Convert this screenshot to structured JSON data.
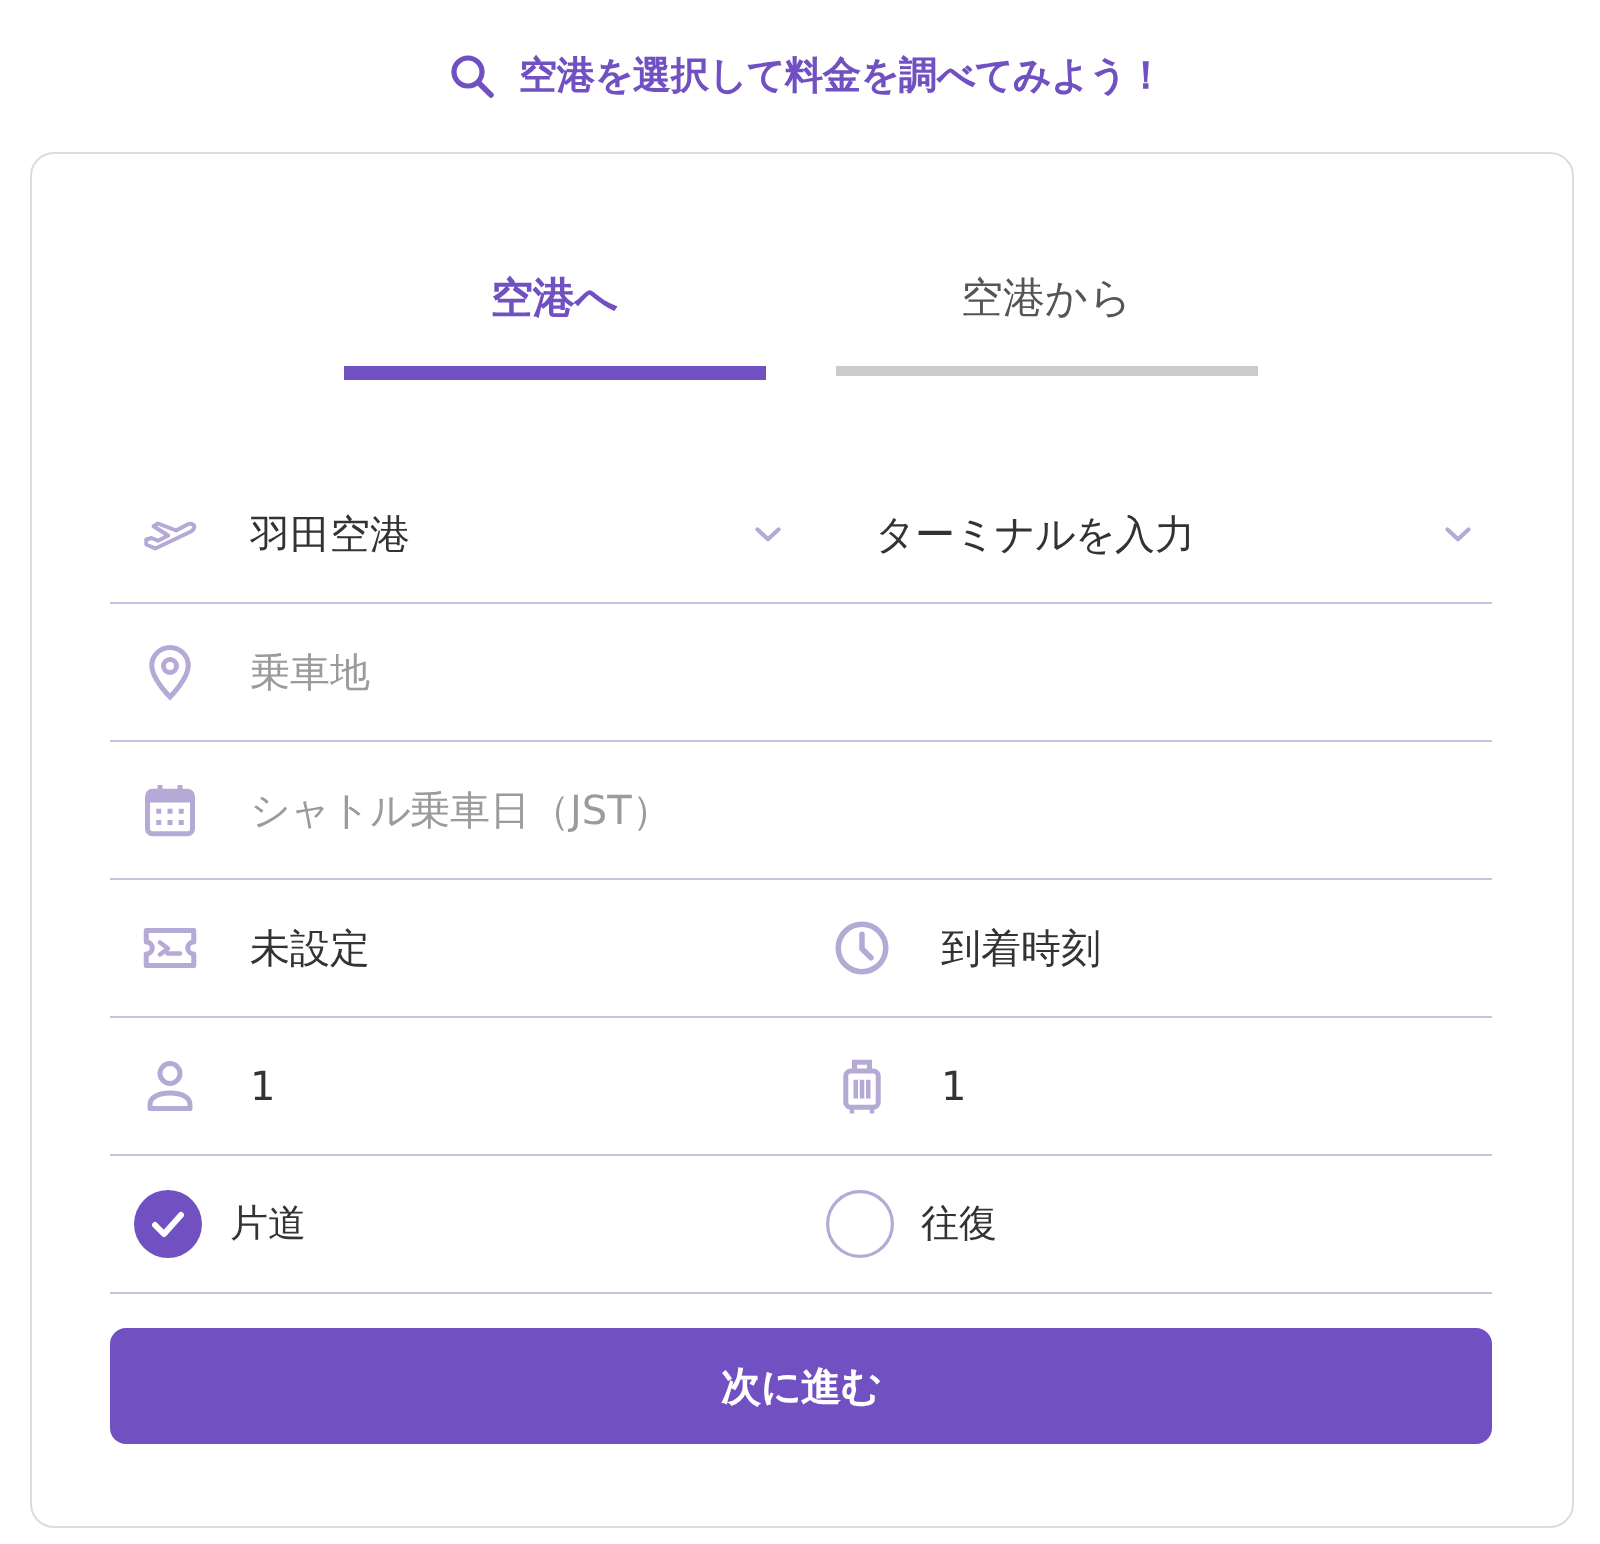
{
  "heading": {
    "text": "空港を選択して料金を調べてみよう！"
  },
  "tabs": [
    {
      "label": "空港へ",
      "selected": true
    },
    {
      "label": "空港から",
      "selected": false
    }
  ],
  "form": {
    "airport": {
      "value": "羽田空港"
    },
    "terminal": {
      "value": "ターミナルを入力"
    },
    "pickup_location": {
      "placeholder": "乗車地"
    },
    "shuttle_date": {
      "placeholder": "シャトル乗車日（JST）"
    },
    "flight": {
      "value": "未設定"
    },
    "arrival_time": {
      "value": "到着時刻"
    },
    "passengers": {
      "value": "1"
    },
    "luggage": {
      "value": "1"
    },
    "trip_type": [
      {
        "label": "片道",
        "selected": true
      },
      {
        "label": "往復",
        "selected": false
      }
    ]
  },
  "submit_button": {
    "label": "次に進む"
  }
}
